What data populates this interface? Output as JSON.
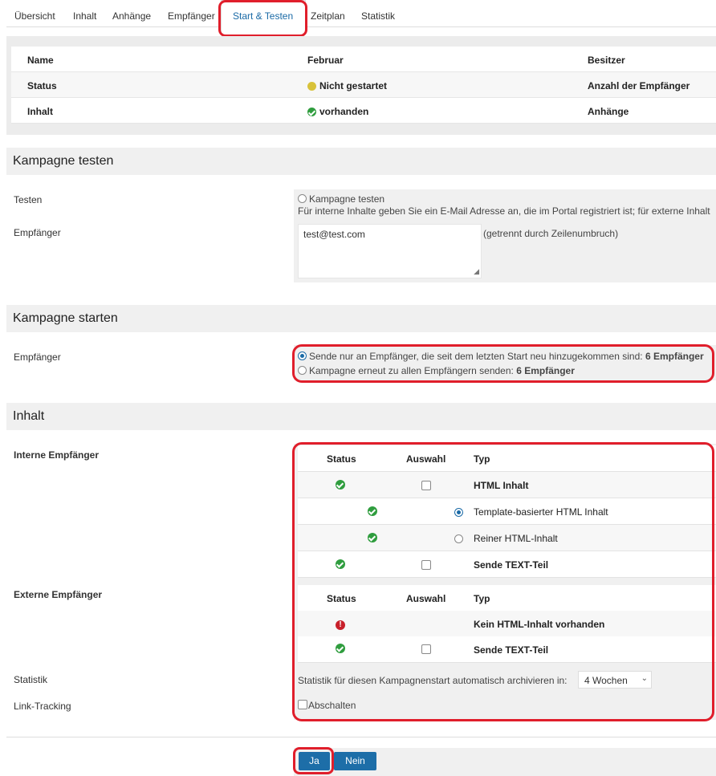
{
  "tabs": [
    "Übersicht",
    "Inhalt",
    "Anhänge",
    "Empfänger",
    "Start & Testen",
    "Zeitplan",
    "Statistik"
  ],
  "summary": {
    "row1": {
      "c1": "Name",
      "c2": "Februar",
      "c3": "Besitzer"
    },
    "row2": {
      "c1": "Status",
      "c2": "Nicht gestartet",
      "c3": "Anzahl der Empfänger"
    },
    "row3": {
      "c1": "Inhalt",
      "c2": "vorhanden",
      "c3": "Anhänge"
    }
  },
  "test": {
    "title": "Kampagne testen",
    "testen_label": "Testen",
    "option": "Kampagne testen",
    "hint": "Für interne Inhalte geben Sie ein E-Mail Adresse an, die im Portal registriert ist; für externe Inhalt",
    "empfaenger_label": "Empfänger",
    "textarea_value": "test@test.com",
    "textarea_note": "(getrennt durch Zeilenumbruch)"
  },
  "start": {
    "title": "Kampagne starten",
    "empfaenger_label": "Empfänger",
    "option1_text": "Sende nur an Empfänger, die seit dem letzten Start neu hinzugekommen sind:",
    "option1_count": "6 Empfänger",
    "option2_text": "Kampagne erneut zu allen Empfängern senden:",
    "option2_count": "6 Empfänger",
    "selected": "option1"
  },
  "inhalt": {
    "title": "Inhalt",
    "intern_label": "Interne Empfänger",
    "extern_label": "Externe Empfänger",
    "col_status": "Status",
    "col_auswahl": "Auswahl",
    "col_typ": "Typ",
    "intern_rows": [
      {
        "typ": "HTML Inhalt",
        "status": "ok",
        "control": "checkbox"
      },
      {
        "typ": "Template-basierter HTML Inhalt",
        "status": "ok",
        "control": "radio-on"
      },
      {
        "typ": "Reiner HTML-Inhalt",
        "status": "ok",
        "control": "radio-off"
      },
      {
        "typ": "Sende TEXT-Teil",
        "status": "ok",
        "control": "checkbox"
      }
    ],
    "extern_rows": [
      {
        "typ": "Kein HTML-Inhalt vorhanden",
        "status": "error"
      },
      {
        "typ": "Sende TEXT-Teil",
        "status": "ok",
        "control": "checkbox"
      }
    ],
    "statistik_label": "Statistik",
    "statistik_text": "Statistik für diesen Kampagnenstart automatisch archivieren in:",
    "statistik_value": "4 Wochen",
    "tracking_label": "Link-Tracking",
    "tracking_text": "Abschalten"
  },
  "buttons": {
    "yes": "Ja",
    "no": "Nein"
  },
  "colors": {
    "accent": "#1d6ea8",
    "highlight": "#e01e2b",
    "ok": "#2f9d3e",
    "error": "#c8202b"
  }
}
